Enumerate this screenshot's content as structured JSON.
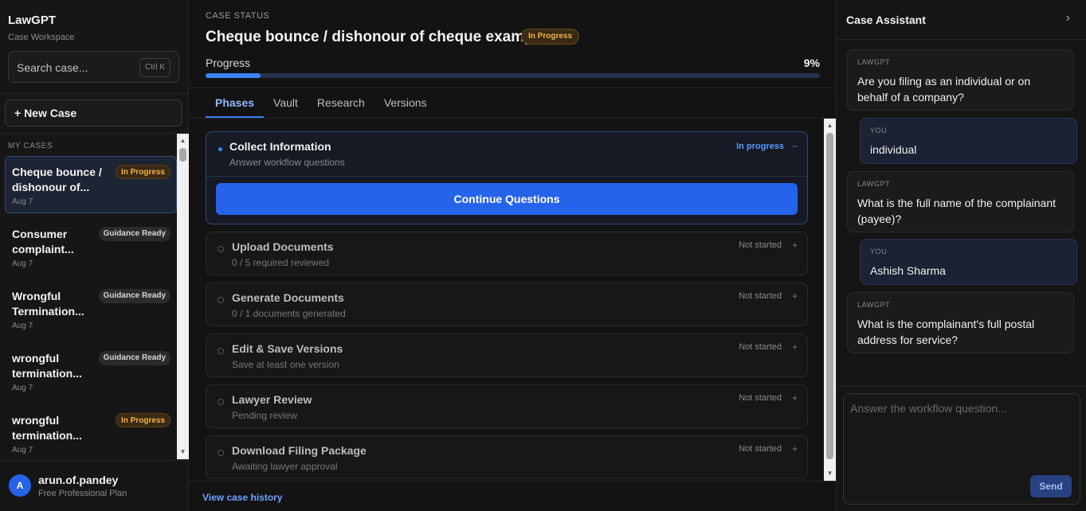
{
  "sidebar": {
    "brand": "LawGPT",
    "brand_sub": "Case Workspace",
    "search_placeholder": "Search case...",
    "search_shortcut": "Ctrl K",
    "new_case_label": "+ New Case",
    "section_label": "MY CASES",
    "cases": [
      {
        "title": "Cheque bounce / dishonour of...",
        "badge": "In Progress",
        "badge_type": "progress",
        "date": "Aug 7",
        "active": true
      },
      {
        "title": "Consumer complaint...",
        "badge": "Guidance Ready",
        "badge_type": "ready",
        "date": "Aug 7",
        "active": false
      },
      {
        "title": "Wrongful Termination...",
        "badge": "Guidance Ready",
        "badge_type": "ready",
        "date": "Aug 7",
        "active": false
      },
      {
        "title": "wrongful termination...",
        "badge": "Guidance Ready",
        "badge_type": "ready",
        "date": "Aug 7",
        "active": false
      },
      {
        "title": "wrongful termination...",
        "badge": "In Progress",
        "badge_type": "progress",
        "date": "Aug 7",
        "active": false
      }
    ],
    "user": {
      "initial": "A",
      "name": "arun.of.pandey",
      "plan": "Free Professional Plan"
    }
  },
  "main": {
    "status_label": "CASE STATUS",
    "title": "Cheque bounce / dishonour of cheque example",
    "status_badge": "In Progress",
    "progress_label": "Progress",
    "progress_percent_text": "9%",
    "progress_value": 0.09,
    "tabs": [
      {
        "label": "Phases",
        "active": true
      },
      {
        "label": "Vault",
        "active": false
      },
      {
        "label": "Research",
        "active": false
      },
      {
        "label": "Versions",
        "active": false
      }
    ],
    "phases": [
      {
        "title": "Collect Information",
        "subtitle": "Answer workflow questions",
        "status": "In progress",
        "toggle": "–",
        "open": true,
        "action": "Continue Questions"
      },
      {
        "title": "Upload Documents",
        "subtitle": "0 / 5 required reviewed",
        "status": "Not started",
        "toggle": "+",
        "open": false
      },
      {
        "title": "Generate Documents",
        "subtitle": "0 / 1 documents generated",
        "status": "Not started",
        "toggle": "+",
        "open": false
      },
      {
        "title": "Edit & Save Versions",
        "subtitle": "Save at least one version",
        "status": "Not started",
        "toggle": "+",
        "open": false
      },
      {
        "title": "Lawyer Review",
        "subtitle": "Pending review",
        "status": "Not started",
        "toggle": "+",
        "open": false
      },
      {
        "title": "Download Filing Package",
        "subtitle": "Awaiting lawyer approval",
        "status": "Not started",
        "toggle": "+",
        "open": false
      }
    ],
    "view_history": "View case history"
  },
  "assistant": {
    "title": "Case Assistant",
    "messages": [
      {
        "from": "LAWGPT",
        "text": "Are you filing as an individual or on behalf of a company?",
        "you": false
      },
      {
        "from": "YOU",
        "text": "individual",
        "you": true
      },
      {
        "from": "LAWGPT",
        "text": "What is the full name of the complainant (payee)?",
        "you": false
      },
      {
        "from": "YOU",
        "text": "Ashish Sharma",
        "you": true
      },
      {
        "from": "LAWGPT",
        "text": "What is the complainant's full postal address for service?",
        "you": false
      }
    ],
    "input_placeholder": "Answer the workflow question...",
    "send_label": "Send"
  },
  "colors": {
    "accent": "#2563eb",
    "in_progress": "#f0b34a",
    "link": "#6ea2ff"
  }
}
